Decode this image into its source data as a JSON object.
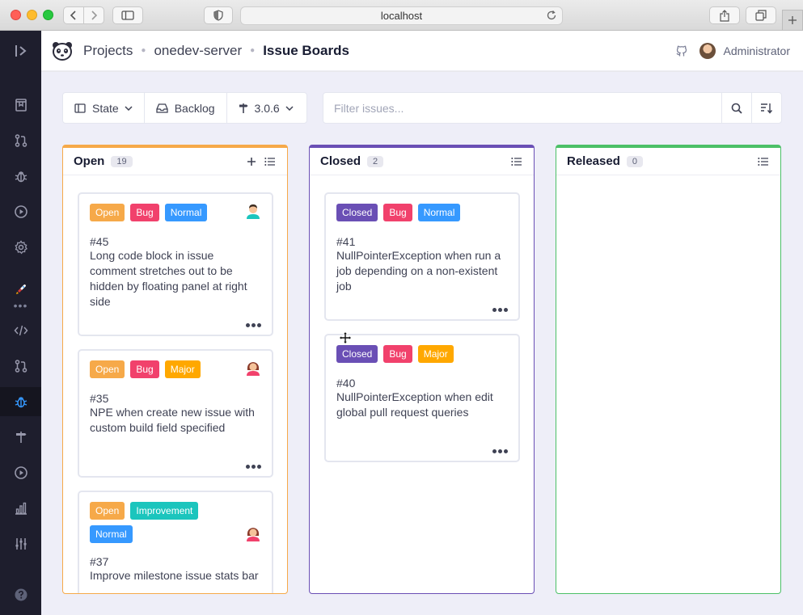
{
  "browser": {
    "url": "localhost"
  },
  "header": {
    "breadcrumbs": [
      "Projects",
      "onedev-server",
      "Issue Boards"
    ],
    "user_name": "Administrator"
  },
  "toolbar": {
    "state_label": "State",
    "backlog_label": "Backlog",
    "milestone_label": "3.0.6",
    "filter_placeholder": "Filter issues..."
  },
  "columns": [
    {
      "title": "Open",
      "count": "19",
      "color": "#f6a949",
      "cards": [
        {
          "labels": [
            "Open",
            "Bug",
            "Normal"
          ],
          "number": "#45",
          "title": "Long code block in issue comment stretches out to be hidden by floating panel at right side"
        },
        {
          "labels": [
            "Open",
            "Bug",
            "Major"
          ],
          "number": "#35",
          "title": "NPE when create new issue with custom build field specified"
        },
        {
          "labels": [
            "Open",
            "Improvement",
            "Normal"
          ],
          "number": "#37",
          "title": "Improve milestone issue stats bar"
        }
      ]
    },
    {
      "title": "Closed",
      "count": "2",
      "color": "#6a4fb5",
      "cards": [
        {
          "labels": [
            "Closed",
            "Bug",
            "Normal"
          ],
          "number": "#41",
          "title": "NullPointerException when run a job depending on a non-existent job"
        },
        {
          "labels": [
            "Closed",
            "Bug",
            "Major"
          ],
          "number": "#40",
          "title": "NullPointerException when edit global pull request queries"
        }
      ]
    },
    {
      "title": "Released",
      "count": "0",
      "color": "#4cc067",
      "cards": []
    }
  ],
  "label_colors": {
    "Open": "#f6a949",
    "Closed": "#6a4fb5",
    "Bug": "#f1416c",
    "Normal": "#3699ff",
    "Major": "#ffa800",
    "Improvement": "#1bc5bd"
  }
}
